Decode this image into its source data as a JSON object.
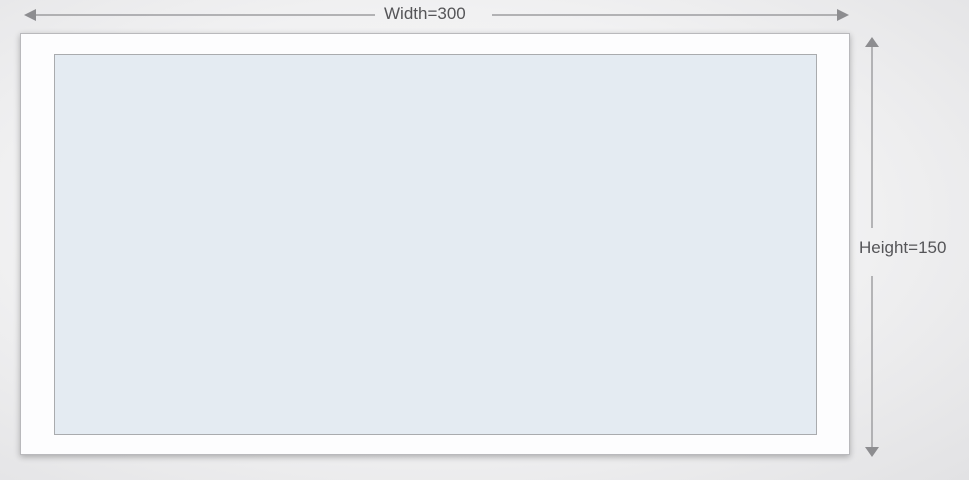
{
  "dimensions": {
    "width_label": "Width=300",
    "height_label": "Height=150"
  },
  "colors": {
    "canvas_fill": "#e4ebf2",
    "frame_fill": "#fdfdfe",
    "arrow": "#8d8d90",
    "label": "#555558"
  }
}
